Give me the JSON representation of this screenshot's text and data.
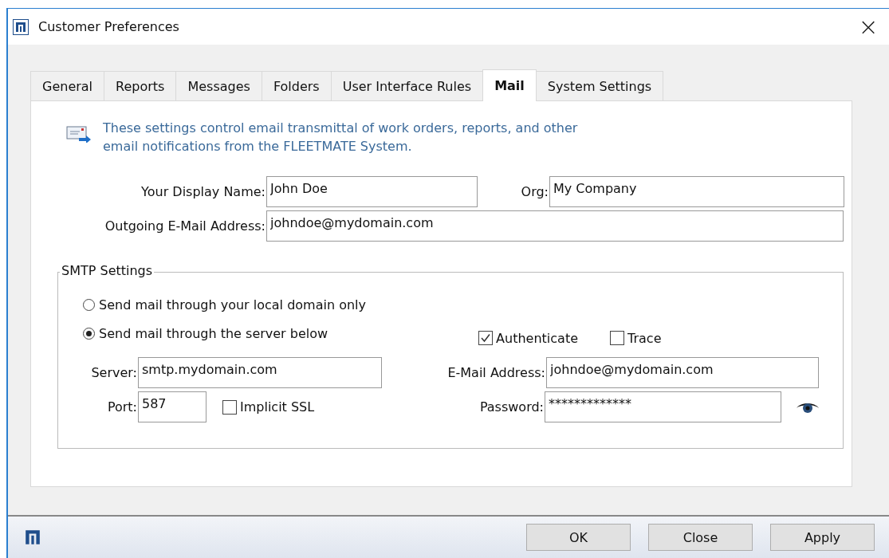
{
  "window": {
    "title": "Customer Preferences",
    "close": "×"
  },
  "tabs": [
    {
      "label": "General",
      "selected": false
    },
    {
      "label": "Reports",
      "selected": false
    },
    {
      "label": "Messages",
      "selected": false
    },
    {
      "label": "Folders",
      "selected": false
    },
    {
      "label": "User Interface Rules",
      "selected": false
    },
    {
      "label": "Mail",
      "selected": true
    },
    {
      "label": "System Settings",
      "selected": false
    }
  ],
  "info": "These settings control email transmittal of work orders, reports, and other email notifications from the FLEETMATE System.",
  "fields": {
    "display_name": {
      "label": "Your Display Name:",
      "value": "John Doe"
    },
    "org": {
      "label": "Org:",
      "value": "My Company"
    },
    "outgoing": {
      "label": "Outgoing E-Mail Address:",
      "value": "johndoe@mydomain.com"
    }
  },
  "smtp": {
    "title": "SMTP Settings",
    "options": [
      {
        "label": "Send mail through your local domain only",
        "selected": false
      },
      {
        "label": "Send mail through the server below",
        "selected": true
      }
    ],
    "authenticate": {
      "label": "Authenticate",
      "checked": true
    },
    "trace": {
      "label": "Trace",
      "checked": false
    },
    "server": {
      "label": "Server:",
      "value": "smtp.mydomain.com"
    },
    "email": {
      "label": "E-Mail Address:",
      "value": "johndoe@mydomain.com"
    },
    "port": {
      "label": "Port:",
      "value": "587"
    },
    "implicit_ssl": {
      "label": "Implicit SSL",
      "checked": false
    },
    "password": {
      "label": "Password:",
      "value": "*************"
    }
  },
  "buttons": [
    "OK",
    "Close",
    "Apply"
  ]
}
